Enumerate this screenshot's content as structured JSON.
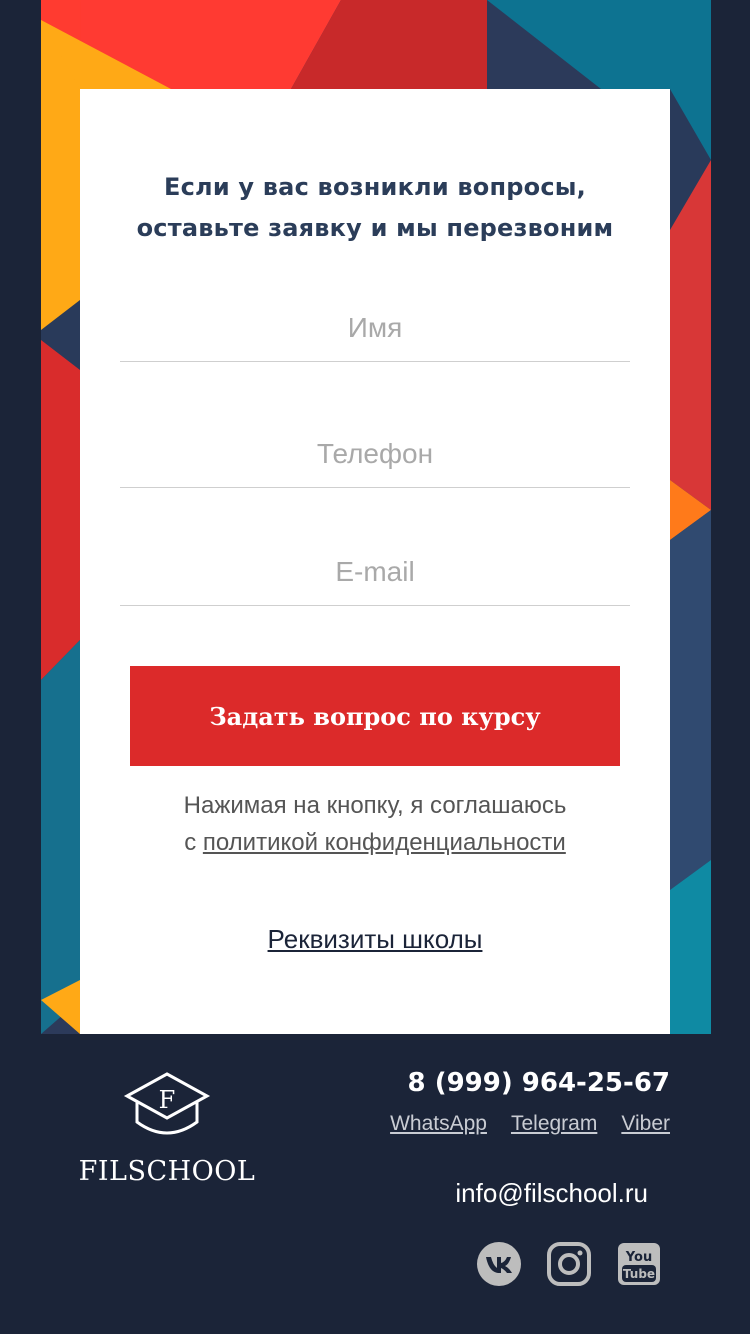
{
  "form": {
    "title_line1": "Если у вас возникли вопросы,",
    "title_line2": "оставьте заявку и мы перезвоним",
    "name_placeholder": "Имя",
    "phone_placeholder": "Телефон",
    "email_placeholder": "E-mail",
    "submit_label": "Задать вопрос по курсу",
    "consent_text": "Нажимая на кнопку, я соглашаюсь",
    "consent_prefix": "с ",
    "consent_link": "политикой конфиденциальности",
    "requisites_link": "Реквизиты школы"
  },
  "footer": {
    "logo_letter": "F",
    "logo_text": "FILSCHOOL",
    "phone": "8 (999) 964-25-67",
    "messengers": [
      "WhatsApp",
      "Telegram",
      "Viber"
    ],
    "email": "info@filschool.ru",
    "social_icons": [
      "vk-icon",
      "instagram-icon",
      "youtube-icon"
    ]
  },
  "colors": {
    "background": "#1b2438",
    "accent_red": "#dc2a2a",
    "title_text": "#2b3d59"
  }
}
